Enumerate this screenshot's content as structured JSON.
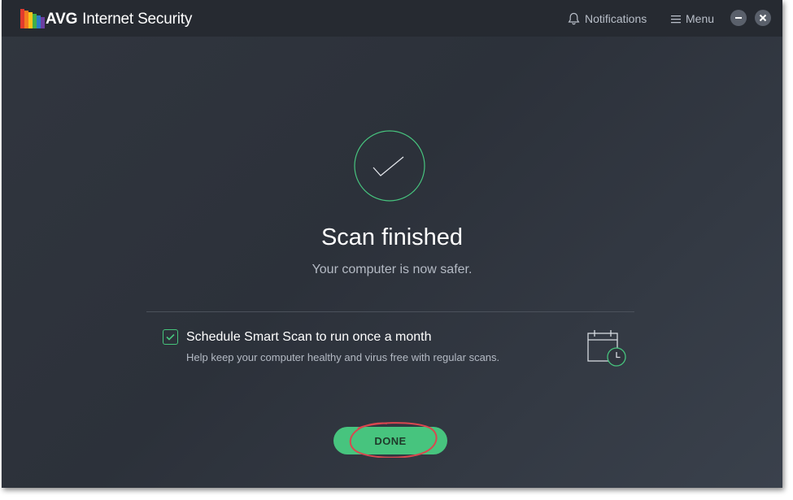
{
  "app": {
    "brand": "AVG",
    "product": "Internet Security"
  },
  "header": {
    "notifications_label": "Notifications",
    "menu_label": "Menu"
  },
  "result": {
    "title": "Scan finished",
    "subtitle": "Your computer is now safer."
  },
  "schedule": {
    "checked": true,
    "title": "Schedule Smart Scan to run once a month",
    "description": "Help keep your computer healthy and virus free with regular scans."
  },
  "actions": {
    "done_label": "DONE"
  },
  "colors": {
    "accent_green": "#47c47e",
    "annotation_red": "#d9474f",
    "background": "#2e333b"
  }
}
